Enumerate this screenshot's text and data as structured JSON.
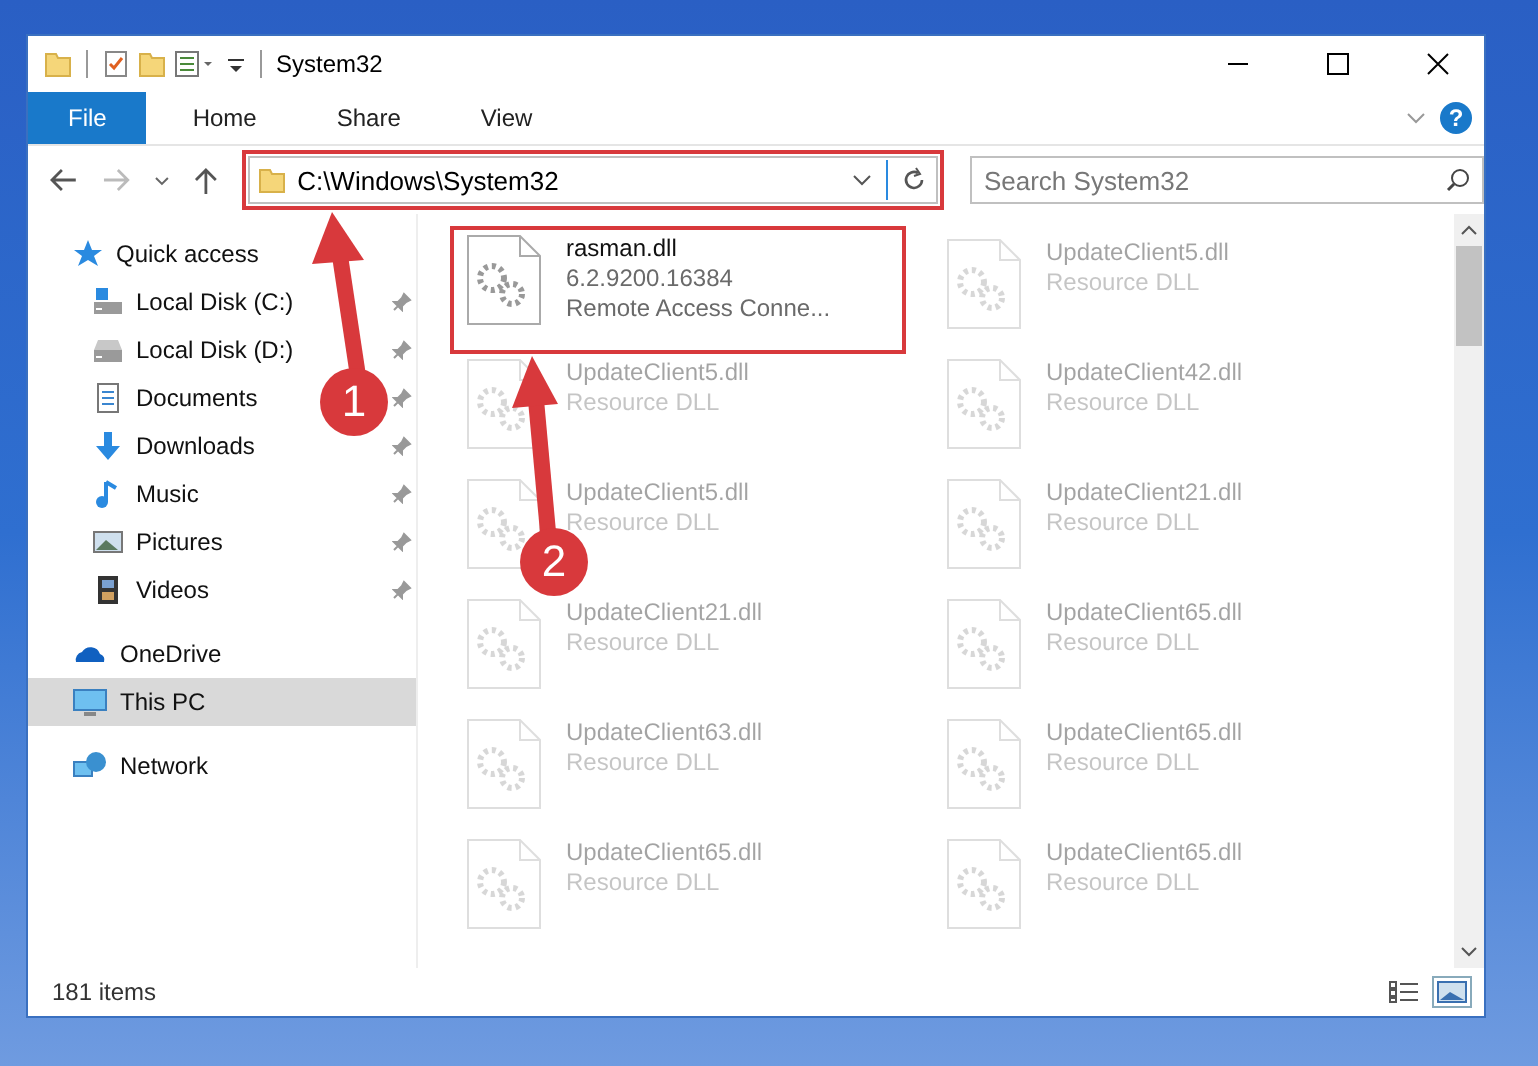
{
  "window": {
    "title": "System32"
  },
  "ribbon": {
    "tabs": [
      {
        "label": "File",
        "kind": "file"
      },
      {
        "label": "Home",
        "kind": "tab"
      },
      {
        "label": "Share",
        "kind": "tab"
      },
      {
        "label": "View",
        "kind": "tab"
      }
    ],
    "help": "?"
  },
  "address": {
    "path": "C:\\Windows\\System32",
    "highlighted": true,
    "search_placeholder": "Search System32"
  },
  "sidebar": {
    "items": [
      {
        "label": "Quick access",
        "selected": false,
        "children": [
          {
            "label": "Local Disk (C:)",
            "pinned": true
          },
          {
            "label": "Local Disk (D:)",
            "pinned": true
          },
          {
            "label": "Documents",
            "pinned": true
          },
          {
            "label": "Downloads",
            "pinned": true
          },
          {
            "label": "Music",
            "pinned": true
          },
          {
            "label": "Pictures",
            "pinned": true
          },
          {
            "label": "Videos",
            "pinned": true
          }
        ]
      },
      {
        "label": "OneDrive",
        "selected": false
      },
      {
        "label": "This PC",
        "selected": true
      },
      {
        "label": "Network",
        "selected": false
      }
    ]
  },
  "files": {
    "columns": [
      [
        {
          "name": "rasman.dll",
          "lines": [
            "6.2.9200.16384",
            "Remote Access Conne..."
          ],
          "blurred": false,
          "highlighted": true
        },
        {
          "name": "UpdateClient5.dll",
          "lines": [
            "Resource DLL"
          ],
          "blurred": true
        },
        {
          "name": "UpdateClient5.dll",
          "lines": [
            "Resource DLL"
          ],
          "blurred": true
        },
        {
          "name": "UpdateClient21.dll",
          "lines": [
            "Resource DLL"
          ],
          "blurred": true
        },
        {
          "name": "UpdateClient63.dll",
          "lines": [
            "Resource DLL"
          ],
          "blurred": true
        },
        {
          "name": "UpdateClient65.dll",
          "lines": [
            "Resource DLL"
          ],
          "blurred": true
        }
      ],
      [
        {
          "name": "UpdateClient5.dll",
          "lines": [
            "Resource DLL"
          ],
          "blurred": true
        },
        {
          "name": "UpdateClient42.dll",
          "lines": [
            "Resource DLL"
          ],
          "blurred": true
        },
        {
          "name": "UpdateClient21.dll",
          "lines": [
            "Resource DLL"
          ],
          "blurred": true
        },
        {
          "name": "UpdateClient65.dll",
          "lines": [
            "Resource DLL"
          ],
          "blurred": true
        },
        {
          "name": "UpdateClient65.dll",
          "lines": [
            "Resource DLL"
          ],
          "blurred": true
        },
        {
          "name": "UpdateClient65.dll",
          "lines": [
            "Resource DLL"
          ],
          "blurred": true
        }
      ]
    ]
  },
  "status_bar": {
    "count": "181 items",
    "views": [
      {
        "selected": false
      },
      {
        "selected": true
      }
    ]
  },
  "annotations": [
    {
      "number": "1"
    },
    {
      "number": "2"
    }
  ]
}
